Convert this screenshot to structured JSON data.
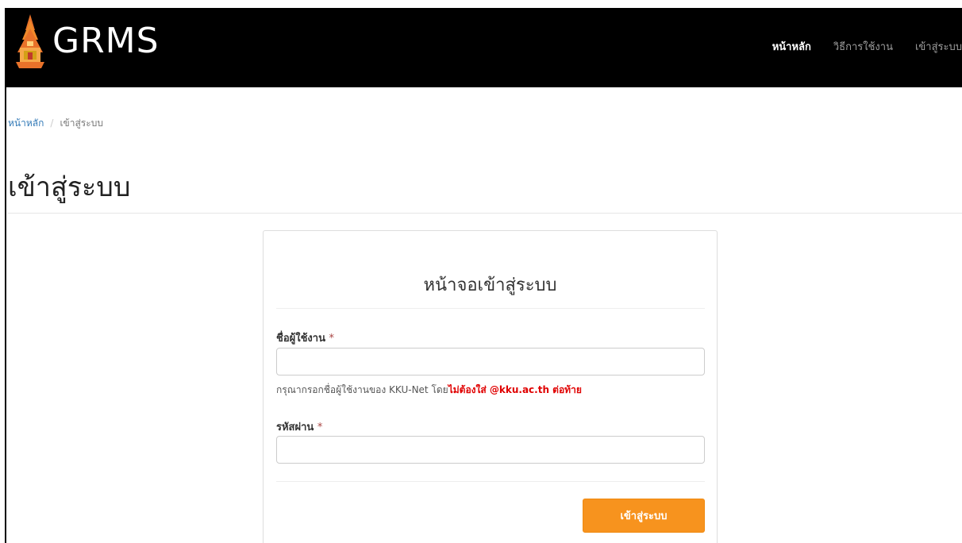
{
  "navbar": {
    "brand": "GRMS",
    "menu": [
      {
        "label": "หน้าหลัก",
        "active": true
      },
      {
        "label": "วิธีการใช้งาน",
        "active": false
      },
      {
        "label": "เข้าสู่ระบบ",
        "active": false
      }
    ]
  },
  "breadcrumb": {
    "home": "หน้าหลัก",
    "separator": "/",
    "current": "เข้าสู่ระบบ"
  },
  "page": {
    "title": "เข้าสู่ระบบ"
  },
  "login_card": {
    "title": "หน้าจอเข้าสู่ระบบ",
    "username_label": "ชื่อผู้ใช้งาน",
    "username_value": "",
    "required_mark": "*",
    "help_text_prefix": "กรุณากรอกชื่อผู้ใช้งานของ KKU-Net โดย",
    "help_text_warning": "ไม่ต้องใส่ @kku.ac.th ต่อท้าย",
    "password_label": "รหัสผ่าน",
    "password_value": "",
    "submit_label": "เข้าสู่ระบบ"
  },
  "colors": {
    "navbar_bg": "#000000",
    "accent_button": "#f7931e",
    "link": "#337ab7",
    "warning_text": "#e00000",
    "required": "#a94442"
  },
  "icons": {
    "logo": "temple-logo-icon"
  }
}
